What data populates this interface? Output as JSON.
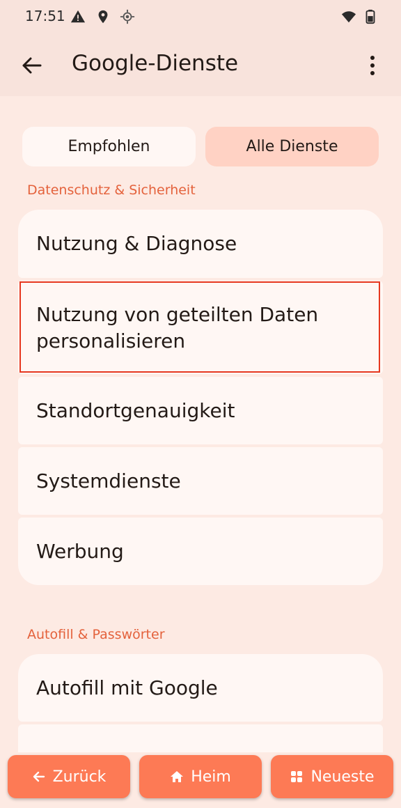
{
  "status_bar": {
    "time": "17:51",
    "icons": [
      "warning-icon",
      "location-pin-icon",
      "gps-icon",
      "wifi-icon",
      "battery-icon"
    ]
  },
  "app_bar": {
    "title": "Google-Dienste",
    "back_icon": "arrow-left-icon",
    "menu_icon": "more-vert-icon"
  },
  "tabs": [
    {
      "label": "Empfohlen",
      "selected": false
    },
    {
      "label": "Alle Dienste",
      "selected": true
    }
  ],
  "sections": [
    {
      "title": "Datenschutz & Sicherheit",
      "items": [
        "Nutzung & Diagnose",
        "Nutzung von geteilten Daten personalisieren",
        "Standortgenauigkeit",
        "Systemdienste",
        "Werbung"
      ]
    },
    {
      "title": "Autofill & Passwörter",
      "items": [
        "Autofill mit Google"
      ]
    }
  ],
  "bottom_nav": {
    "back": "Zurück",
    "home": "Heim",
    "recent": "Neueste"
  },
  "colors": {
    "background": "#fdeae3",
    "accent": "#e4623c",
    "nav_button": "#fd7a55",
    "highlight": "#e6371f"
  }
}
